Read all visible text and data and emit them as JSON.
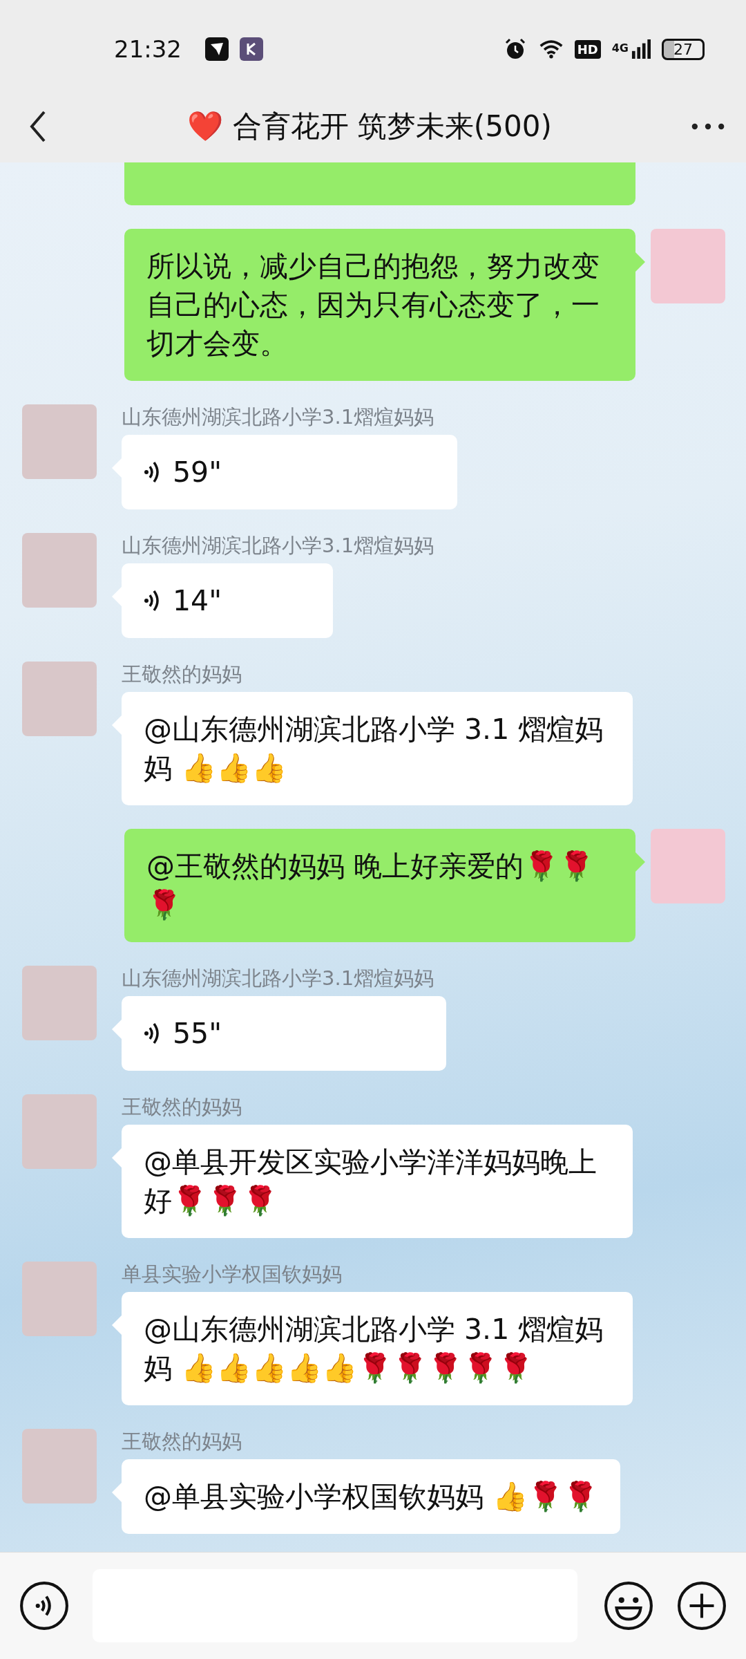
{
  "status_bar": {
    "time": "21:32",
    "network_badge": "HD",
    "network_type": "4G",
    "battery": "27"
  },
  "header": {
    "title": "❤️  合育花开 筑梦未来(500)"
  },
  "messages": [
    {
      "kind": "text",
      "outgoing": true
    },
    {
      "kind": "text",
      "outgoing": true,
      "text": "所以说，减少自己的抱怨，努力改变自己的心态，因为只有心态变了，一切才会变。"
    },
    {
      "kind": "voice",
      "outgoing": false,
      "sender": "山东德州湖滨北路小学3.1熠煊妈妈",
      "duration": "59\""
    },
    {
      "kind": "voice",
      "outgoing": false,
      "sender": "山东德州湖滨北路小学3.1熠煊妈妈",
      "duration": "14\""
    },
    {
      "kind": "text",
      "outgoing": false,
      "sender": "王敬然的妈妈",
      "text": "@山东德州湖滨北路小学 3.1 熠煊妈妈  👍👍👍"
    },
    {
      "kind": "text",
      "outgoing": true,
      "text": "@王敬然的妈妈  晚上好亲爱的🌹🌹🌹"
    },
    {
      "kind": "voice",
      "outgoing": false,
      "sender": "山东德州湖滨北路小学3.1熠煊妈妈",
      "duration": "55\""
    },
    {
      "kind": "text",
      "outgoing": false,
      "sender": "王敬然的妈妈",
      "text": "@单县开发区实验小学洋洋妈妈晚上好🌹🌹🌹"
    },
    {
      "kind": "text",
      "outgoing": false,
      "sender": "单县实验小学权国钦妈妈",
      "text": "@山东德州湖滨北路小学 3.1 熠煊妈妈  👍👍👍👍👍🌹🌹🌹🌹🌹"
    },
    {
      "kind": "text",
      "outgoing": false,
      "sender": "王敬然的妈妈",
      "text": "@单县实验小学权国钦妈妈  👍🌹🌹"
    }
  ]
}
